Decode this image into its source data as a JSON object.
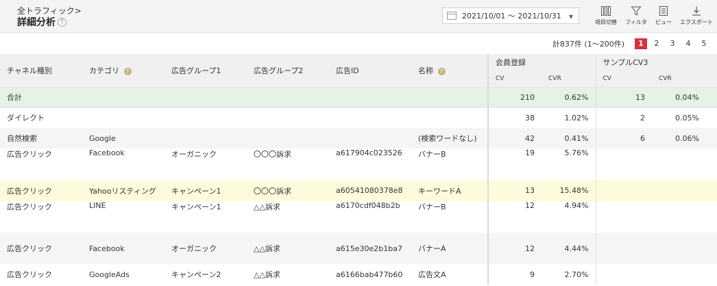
{
  "header": {
    "breadcrumb": "全トラフィック>",
    "title": "詳細分析",
    "help_mark": "?",
    "date_range": "2021/10/01 ～ 2021/10/31",
    "tools": [
      {
        "label": "項目切替",
        "icon": "columns-icon"
      },
      {
        "label": "フィルタ",
        "icon": "filter-icon"
      },
      {
        "label": "ビュー",
        "icon": "view-icon"
      },
      {
        "label": "エクスポート",
        "icon": "download-icon"
      }
    ]
  },
  "pagination": {
    "count_text": "計837件 (1～200件)",
    "pages": [
      "1",
      "2",
      "3",
      "4",
      "5"
    ],
    "active_page": "1"
  },
  "table": {
    "columns": [
      "チャネル種別",
      "カテゴリ",
      "広告グループ1",
      "広告グループ2",
      "広告ID",
      "名称"
    ],
    "metric_groups": [
      {
        "name": "会員登録",
        "subcolumns": [
          "CV",
          "CVR"
        ]
      },
      {
        "name": "サンプルCV3",
        "subcolumns": [
          "CV",
          "CVR"
        ]
      }
    ],
    "total": {
      "label": "合計",
      "cv1": "210",
      "cvr1": "0.62%",
      "cv2": "13",
      "cvr2": "0.04%"
    },
    "rows": [
      {
        "channel": "ダイレクト",
        "category": "",
        "group1": "",
        "group2": "",
        "ad_id": "",
        "name": "",
        "cv1": "38",
        "cvr1": "1.02%",
        "cv2": "2",
        "cvr2": "0.05%"
      },
      {
        "channel": "自然検索",
        "category": "Google",
        "group1": "",
        "group2": "",
        "ad_id": "",
        "name": "(検索ワードなし)",
        "cv1": "42",
        "cvr1": "0.41%",
        "cv2": "6",
        "cvr2": "0.06%"
      },
      {
        "channel": "広告クリック",
        "category": "Facebook",
        "group1": "オーガニック",
        "group2": "〇〇〇訴求",
        "ad_id": "a617904c023526",
        "name": "バナーB",
        "cv1": "19",
        "cvr1": "5.76%",
        "cv2": "",
        "cvr2": ""
      },
      {
        "channel": "広告クリック",
        "category": "Yahooリスティング",
        "group1": "キャンペーン1",
        "group2": "〇〇〇訴求",
        "ad_id": "a60541080378e8",
        "name": "キーワードA",
        "cv1": "13",
        "cvr1": "15.48%",
        "cv2": "",
        "cvr2": ""
      },
      {
        "channel": "広告クリック",
        "category": "LINE",
        "group1": "キャンペーン1",
        "group2": "△△訴求",
        "ad_id": "a6170cdf048b2b",
        "name": "バナーB",
        "cv1": "12",
        "cvr1": "4.94%",
        "cv2": "",
        "cvr2": ""
      },
      {
        "channel": "広告クリック",
        "category": "Facebook",
        "group1": "オーガニック",
        "group2": "△△訴求",
        "ad_id": "a615e30e2b1ba7",
        "name": "バナーA",
        "cv1": "12",
        "cvr1": "4.44%",
        "cv2": "",
        "cvr2": ""
      },
      {
        "channel": "広告クリック",
        "category": "GoogleAds",
        "group1": "キャンペーン2",
        "group2": "△△訴求",
        "ad_id": "a6166bab477b60",
        "name": "広告文A",
        "cv1": "9",
        "cvr1": "2.70%",
        "cv2": "",
        "cvr2": ""
      }
    ]
  }
}
